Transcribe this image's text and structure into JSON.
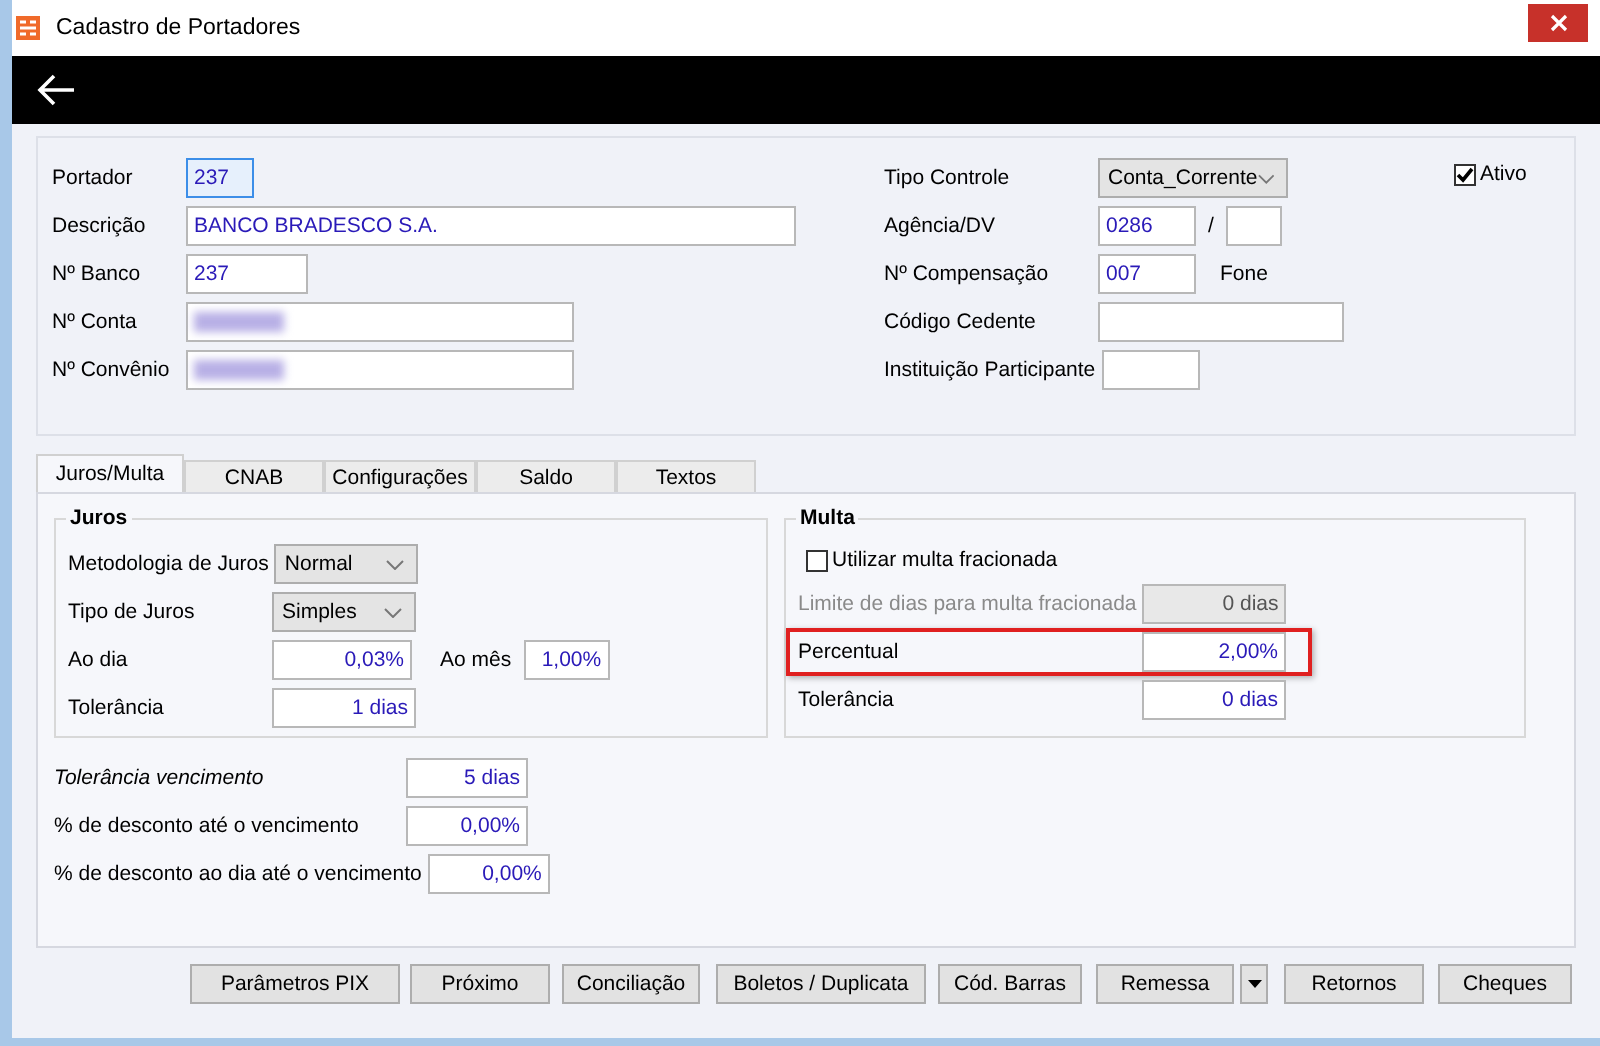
{
  "window": {
    "title": "Cadastro de Portadores"
  },
  "left_fields": [
    {
      "label": "Portador",
      "value": "237",
      "focused": true,
      "redacted": false
    },
    {
      "label": "Descrição",
      "value": "BANCO BRADESCO S.A.",
      "focused": false,
      "redacted": false
    },
    {
      "label": "Nº Banco",
      "value": "237",
      "focused": false,
      "redacted": false
    },
    {
      "label": "Nº Conta",
      "focused": false,
      "redacted": true
    },
    {
      "label": "Nº Convênio",
      "focused": false,
      "redacted": true
    }
  ],
  "right_fields": [
    {
      "kind": "select",
      "label": "Tipo Controle",
      "value": "Conta_Corrente"
    },
    {
      "kind": "split",
      "label": "Agência/DV",
      "value": "0286",
      "separator": "/"
    },
    {
      "kind": "text",
      "label": "Nº Compensação",
      "value": "007",
      "after_label": "Fone"
    },
    {
      "kind": "text",
      "label": "Código Cedente"
    },
    {
      "kind": "text",
      "label": "Instituição Participante"
    }
  ],
  "active_checkbox": {
    "label": "Ativo",
    "checked": true
  },
  "tabs": [
    {
      "label": "Juros/Multa",
      "selected": true
    },
    {
      "label": "CNAB",
      "selected": false
    },
    {
      "label": "Configurações",
      "selected": false
    },
    {
      "label": "Saldo",
      "selected": false
    },
    {
      "label": "Textos",
      "selected": false
    }
  ],
  "juros": {
    "title": "Juros",
    "rows": [
      {
        "kind": "select",
        "label": "Metodologia de Juros",
        "value": "Normal"
      },
      {
        "kind": "select",
        "label": "Tipo de Juros",
        "value": "Simples"
      },
      {
        "kind": "pair",
        "label": "Ao dia",
        "value": "0,03%",
        "label_2": "Ao mês",
        "value_2": "1,00%"
      },
      {
        "kind": "text",
        "label": "Tolerância",
        "value": "1 dias"
      }
    ]
  },
  "multa": {
    "title": "Multa",
    "checkbox": {
      "label": "Utilizar multa fracionada",
      "checked": false
    },
    "rows": [
      {
        "label": "Limite de dias para multa fracionada",
        "value": "0 dias",
        "disabled": true,
        "highlighted": false
      },
      {
        "label": "Percentual",
        "value": "2,00%",
        "disabled": false,
        "highlighted": true
      },
      {
        "label": "Tolerância",
        "value": "0 dias",
        "disabled": false,
        "highlighted": false
      }
    ]
  },
  "bottom_fields": [
    {
      "label": "Tolerância vencimento",
      "value": "5 dias",
      "italic": true
    },
    {
      "label": "% de desconto até o vencimento",
      "value": "0,00%",
      "italic": false
    },
    {
      "label": "% de desconto ao dia até o vencimento",
      "value": "0,00%",
      "italic": false
    }
  ],
  "buttons": [
    {
      "kind": "button",
      "label": "Parâmetros PIX"
    },
    {
      "kind": "button",
      "label": "Próximo"
    },
    {
      "kind": "button",
      "label": "Conciliação"
    },
    {
      "kind": "button",
      "label": "Boletos / Duplicata"
    },
    {
      "kind": "button",
      "label": "Cód. Barras"
    },
    {
      "kind": "button",
      "label": "Remessa"
    },
    {
      "kind": "dropdown"
    },
    {
      "kind": "button",
      "label": "Retornos"
    },
    {
      "kind": "button",
      "label": "Cheques"
    }
  ]
}
